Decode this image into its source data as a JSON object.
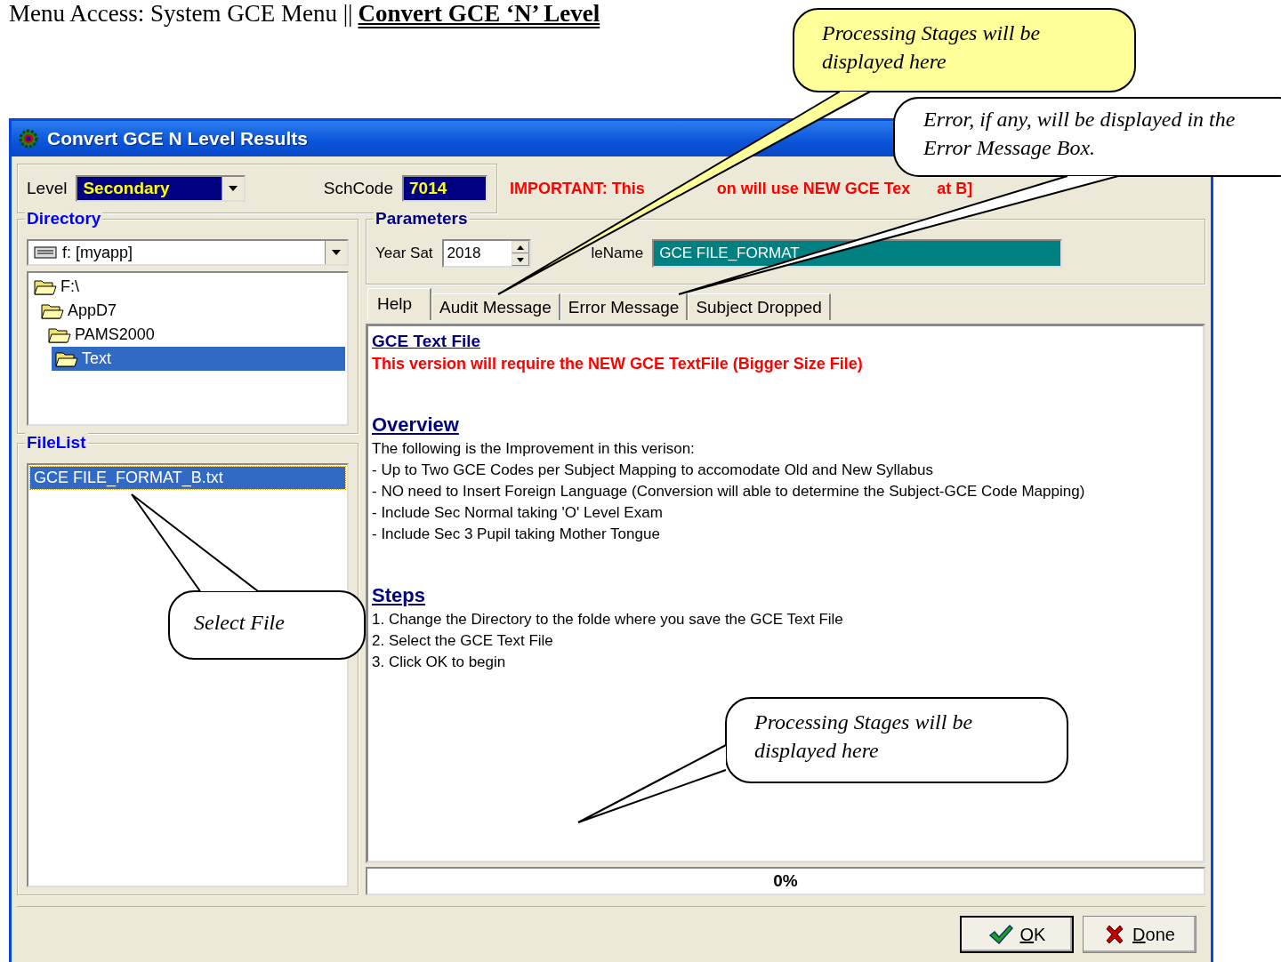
{
  "page_heading": {
    "prefix": "Menu Access: System GCE Menu ||",
    "title": "Convert GCE ‘N’ Level"
  },
  "window": {
    "title": "Convert GCE N Level Results"
  },
  "level": {
    "label": "Level",
    "value": "Secondary"
  },
  "schcode": {
    "label": "SchCode",
    "value": "7014"
  },
  "notice": [
    "IMPORTANT: This",
    "on will use NEW GCE Tex",
    "at B]"
  ],
  "directory": {
    "title": "Directory",
    "drive": "f: [myapp]",
    "tree": [
      {
        "label": "F:\\",
        "selected": false,
        "children": [
          {
            "label": "AppD7",
            "selected": false,
            "children": [
              {
                "label": "PAMS2000",
                "selected": false,
                "children": [
                  {
                    "label": "Text",
                    "selected": true
                  }
                ]
              }
            ]
          }
        ]
      }
    ]
  },
  "filelist": {
    "title": "FileList",
    "files": [
      {
        "name": "GCE FILE_FORMAT_B.txt",
        "selected": true
      }
    ]
  },
  "parameters": {
    "title": "Parameters",
    "year_sat": {
      "label": "Year Sat",
      "value": "2018"
    },
    "filename": {
      "label": "leName",
      "value": "GCE FILE_FORMAT"
    }
  },
  "tabs": [
    {
      "label": "Help",
      "selected": true
    },
    {
      "label": "Audit Message",
      "selected": false
    },
    {
      "label": "Error Message",
      "selected": false
    },
    {
      "label": "Subject Dropped",
      "selected": false
    }
  ],
  "help": [
    {
      "heading": "GCE Text File",
      "kind": "banner",
      "lines": [
        {
          "kind": "warning",
          "text": "This version will require the NEW GCE TextFile (Bigger Size File)"
        }
      ]
    },
    {
      "heading": "Overview",
      "kind": "section",
      "lines": [
        {
          "kind": "plain",
          "text": "The following is the Improvement in this verison:"
        },
        {
          "kind": "plain",
          "text": "- Up to Two GCE Codes per Subject Mapping to accomodate Old and New Syllabus"
        },
        {
          "kind": "plain",
          "text": "- NO need to Insert Foreign Language (Conversion will able to determine the Subject-GCE Code Mapping)"
        },
        {
          "kind": "plain",
          "text": "- Include Sec Normal taking 'O' Level Exam"
        },
        {
          "kind": "plain",
          "text": "- Include Sec 3 Pupil taking Mother Tongue"
        }
      ]
    },
    {
      "heading": "Steps",
      "kind": "section",
      "lines": [
        {
          "kind": "plain",
          "text": "1. Change the Directory to the folde where you save the GCE Text File"
        },
        {
          "kind": "plain",
          "text": "2. Select the GCE Text File"
        },
        {
          "kind": "plain",
          "text": "3. Click OK to begin"
        }
      ]
    }
  ],
  "progress": {
    "level": 0,
    "label": "0%"
  },
  "buttons": [
    {
      "label": "OK",
      "kind": "ok"
    },
    {
      "label": "Done",
      "kind": "done"
    }
  ],
  "callouts": [
    {
      "text": "Processing Stages will be displayed here",
      "kind": "yellow"
    },
    {
      "text": "Error, if any, will be displayed in the Error Message Box.",
      "kind": "white"
    },
    {
      "text": "Select File",
      "kind": "white"
    },
    {
      "text": "Processing Stages will be displayed here",
      "kind": "white"
    }
  ]
}
